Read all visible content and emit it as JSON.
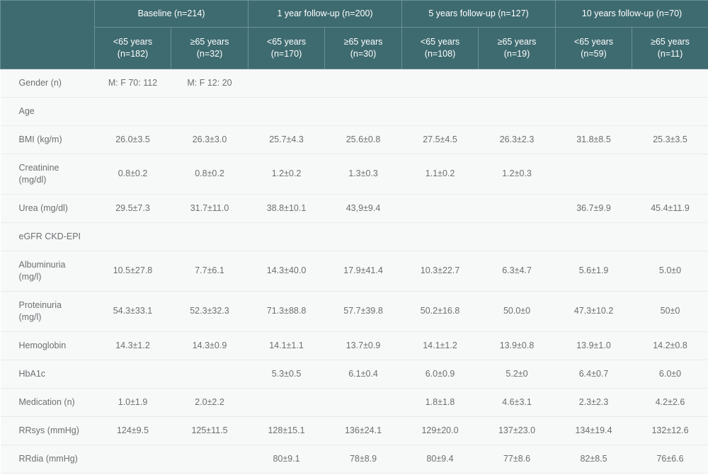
{
  "table": {
    "corner_label": "",
    "groups": [
      {
        "label": "Baseline (n=214)",
        "subcolumns": [
          {
            "age": "<65 years",
            "count": "(n=182)"
          },
          {
            "age": "≥65 years",
            "count": "(n=32)"
          }
        ]
      },
      {
        "label": "1 year follow-up (n=200)",
        "subcolumns": [
          {
            "age": "<65 years",
            "count": "(n=170)"
          },
          {
            "age": "≥65 years",
            "count": "(n=30)"
          }
        ]
      },
      {
        "label": "5 years follow-up (n=127)",
        "subcolumns": [
          {
            "age": "<65 years",
            "count": "(n=108)"
          },
          {
            "age": "≥65 years",
            "count": "(n=19)"
          }
        ]
      },
      {
        "label": "10 years follow-up (n=70)",
        "subcolumns": [
          {
            "age": "<65 years",
            "count": "(n=59)"
          },
          {
            "age": "≥65 years",
            "count": "(n=11)"
          }
        ]
      }
    ],
    "rows": [
      {
        "label_lines": [
          "Gender (n)"
        ],
        "tall": false,
        "values": [
          "M: F 70: 112",
          "M: F 12: 20",
          "",
          "",
          "",
          "",
          "",
          ""
        ]
      },
      {
        "label_lines": [
          "Age"
        ],
        "tall": false,
        "values": [
          "",
          "",
          "",
          "",
          "",
          "",
          "",
          ""
        ]
      },
      {
        "label_lines": [
          "BMI (kg/m)"
        ],
        "tall": false,
        "values": [
          "26.0±3.5",
          "26.3±3.0",
          "25.7±4.3",
          "25.6±0.8",
          "27.5±4.5",
          "26.3±2.3",
          "31.8±8.5",
          "25.3±3.5"
        ]
      },
      {
        "label_lines": [
          "Creatinine",
          "(mg/dl)"
        ],
        "tall": true,
        "values": [
          "0.8±0.2",
          "0.8±0.2",
          "1.2±0.2",
          "1.3±0.3",
          "1.1±0.2",
          "1.2±0.3",
          "",
          ""
        ]
      },
      {
        "label_lines": [
          "Urea (mg/dl)"
        ],
        "tall": false,
        "values": [
          "29.5±7.3",
          "31.7±11.0",
          "38.8±10.1",
          "43,9±9.4",
          "",
          "",
          "36.7±9.9",
          "45.4±11.9"
        ]
      },
      {
        "label_lines": [
          "eGFR CKD-EPI"
        ],
        "tall": false,
        "values": [
          "",
          "",
          "",
          "",
          "",
          "",
          "",
          ""
        ]
      },
      {
        "label_lines": [
          "Albuminuria",
          "(mg/l)"
        ],
        "tall": true,
        "values": [
          "10.5±27.8",
          "7.7±6.1",
          "14.3±40.0",
          "17.9±41.4",
          "10.3±22.7",
          "6.3±4.7",
          "5.6±1.9",
          "5.0±0"
        ]
      },
      {
        "label_lines": [
          "Proteinuria",
          "(mg/l)"
        ],
        "tall": true,
        "values": [
          "54.3±33.1",
          "52.3±32.3",
          "71.3±88.8",
          "57.7±39.8",
          "50.2±16.8",
          "50.0±0",
          "47.3±10.2",
          "50±0"
        ]
      },
      {
        "label_lines": [
          "Hemoglobin"
        ],
        "tall": false,
        "values": [
          "14.3±1.2",
          "14.3±0.9",
          "14.1±1.1",
          "13.7±0.9",
          "14.1±1.2",
          "13.9±0.8",
          "13.9±1.0",
          "14.2±0.8"
        ]
      },
      {
        "label_lines": [
          "HbA1c"
        ],
        "tall": false,
        "values": [
          "",
          "",
          "5.3±0.5",
          "6.1±0.4",
          "6.0±0.9",
          "5.2±0",
          "6.4±0.7",
          "6.0±0"
        ]
      },
      {
        "label_lines": [
          "Medication (n)"
        ],
        "tall": false,
        "values": [
          "1.0±1.9",
          "2.0±2.2",
          "",
          "",
          "1.8±1.8",
          "4.6±3.1",
          "2.3±2.3",
          "4.2±2.6"
        ]
      },
      {
        "label_lines": [
          "RRsys (mmHg)"
        ],
        "tall": false,
        "values": [
          "124±9.5",
          "125±11.5",
          "128±15.1",
          "136±24.1",
          "129±20.0",
          "137±23.0",
          "134±19.4",
          "132±12.6"
        ]
      },
      {
        "label_lines": [
          "RRdia (mmHg)"
        ],
        "tall": false,
        "values": [
          "",
          "",
          "80±9.1",
          "78±8.9",
          "80±9.4",
          "77±8.6",
          "82±8.5",
          "76±6.6"
        ]
      }
    ]
  },
  "colors": {
    "header_background": "#3e6b70",
    "header_border": "#6b9195",
    "header_text": "#ffffff",
    "row_background": "#f7f8f8",
    "row_text": "#6d6f71",
    "row_separator": "#e9eaea"
  }
}
